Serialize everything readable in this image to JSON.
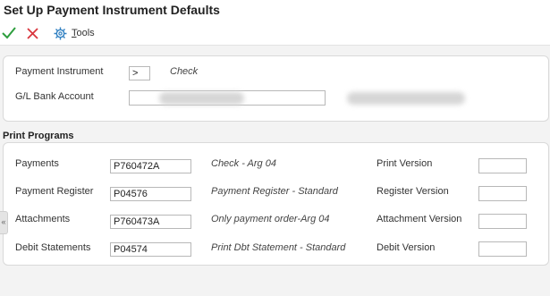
{
  "header": {
    "title": "Set Up Payment Instrument Defaults"
  },
  "toolbar": {
    "ok_icon": "checkmark-icon",
    "cancel_icon": "x-icon",
    "tools_icon": "gear-icon",
    "tools_label_prefix": "T",
    "tools_label_rest": "ools"
  },
  "instrument": {
    "label": "Payment Instrument",
    "value": ">",
    "description": "Check"
  },
  "bank": {
    "label": "G/L Bank Account",
    "value": ""
  },
  "print_programs": {
    "title": "Print Programs",
    "rows": [
      {
        "label": "Payments",
        "program": "P760472A",
        "description": "Check - Arg 04",
        "version_label": "Print Version",
        "version": ""
      },
      {
        "label": "Payment Register",
        "program": "P04576",
        "description": "Payment Register - Standard",
        "version_label": "Register Version",
        "version": ""
      },
      {
        "label": "Attachments",
        "program": "P760473A",
        "description": "Only payment order-Arg 04",
        "version_label": "Attachment Version",
        "version": ""
      },
      {
        "label": "Debit Statements",
        "program": "P04574",
        "description": "Print Dbt Statement - Standard",
        "version_label": "Debit Version",
        "version": ""
      }
    ]
  },
  "colors": {
    "ok": "#2e9e3e",
    "cancel": "#d9363e",
    "tools": "#2f7fc1"
  },
  "side_tab": {
    "glyph": "«"
  }
}
